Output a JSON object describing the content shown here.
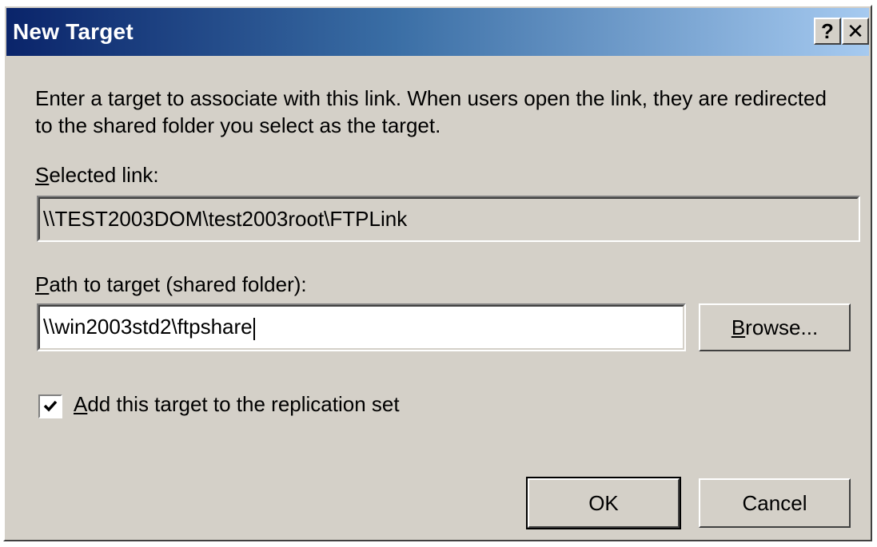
{
  "window": {
    "title": "New Target",
    "help_label": "?",
    "close_label": "✕"
  },
  "instructions": "Enter a target to associate with this link. When users open the link, they are redirected to the shared folder you select as the target.",
  "selected_link": {
    "label": "Selected link:",
    "value": "\\\\TEST2003DOM\\test2003root\\FTPLink"
  },
  "path_to_target": {
    "label": "Path to target (shared folder):",
    "value": "\\\\win2003std2\\ftpshare"
  },
  "browse_button": {
    "label": "Browse..."
  },
  "replication_checkbox": {
    "label": "Add this target to the replication set",
    "checked": true
  },
  "buttons": {
    "ok": "OK",
    "cancel": "Cancel"
  },
  "colors": {
    "dialog_face": "#d4d0c8",
    "titlebar_start": "#0a246a",
    "titlebar_end": "#a6caf0"
  }
}
